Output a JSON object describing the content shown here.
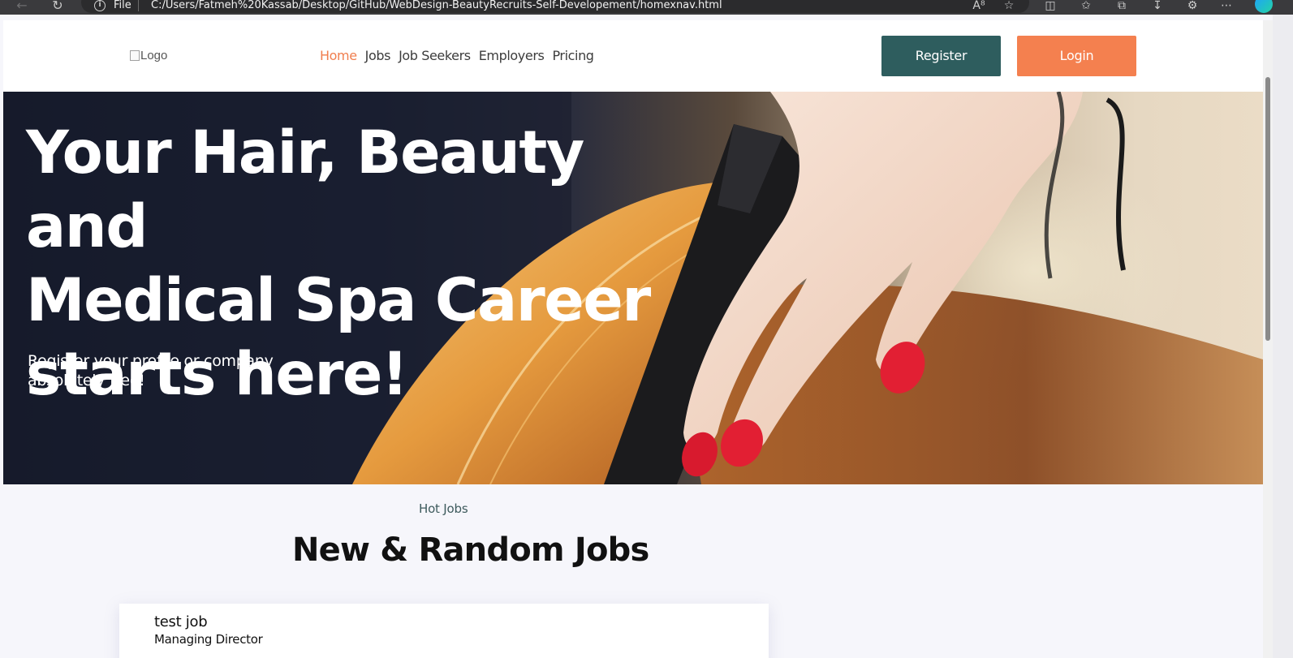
{
  "browser": {
    "scheme_label": "File",
    "url": "C:/Users/Fatmeh%20Kassab/Desktop/GitHub/WebDesign-BeautyRecruits-Self-Developement/homexnav.html",
    "toolbar_icons": [
      "read-aloud-icon",
      "favorite-star-icon",
      "split-screen-icon",
      "favorites-icon",
      "collections-icon",
      "downloads-icon",
      "extensions-icon",
      "more-icon",
      "copilot-icon"
    ]
  },
  "header": {
    "logo_alt": "Logo",
    "nav": [
      {
        "label": "Home",
        "active": true
      },
      {
        "label": "Jobs",
        "active": false
      },
      {
        "label": "Job Seekers",
        "active": false
      },
      {
        "label": "Employers",
        "active": false
      },
      {
        "label": "Pricing",
        "active": false
      }
    ],
    "register_label": "Register",
    "login_label": "Login"
  },
  "hero": {
    "title_line1": "Your Hair, Beauty and",
    "title_line2": "Medical Spa Career",
    "title_line3": "starts here!",
    "subtitle_line1": "Register your profile or company",
    "subtitle_line2": "absolutely free!"
  },
  "jobs_section": {
    "eyebrow": "Hot Jobs",
    "title": "New & Random Jobs",
    "jobs": [
      {
        "title": "test job",
        "company": "Managing Director"
      }
    ]
  },
  "colors": {
    "accent_orange": "#f4804f",
    "teal": "#2e5d5e",
    "nav_active": "#f07e4e",
    "section_bg": "#f6f6fb"
  }
}
